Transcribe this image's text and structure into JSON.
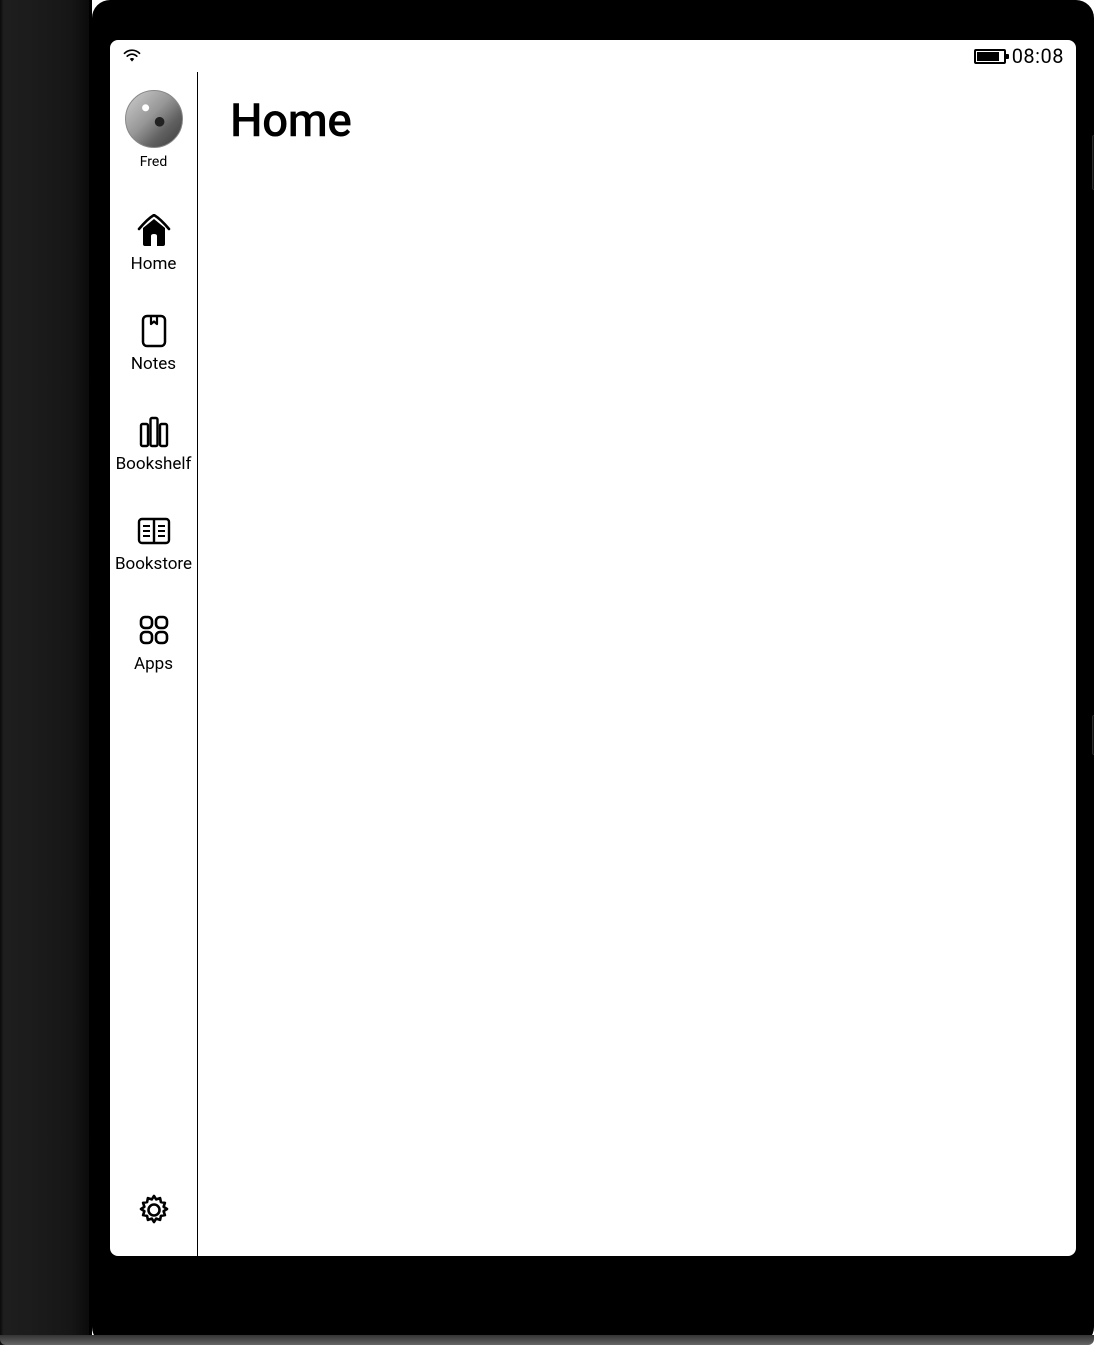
{
  "status": {
    "wifi_strength": 3,
    "battery_percent": 80,
    "clock": "08:08"
  },
  "profile": {
    "name": "Fred"
  },
  "sidebar": {
    "items": [
      {
        "id": "home",
        "label": "Home",
        "icon": "home-icon",
        "active": true
      },
      {
        "id": "notes",
        "label": "Notes",
        "icon": "notebook-icon",
        "active": false
      },
      {
        "id": "bookshelf",
        "label": "Bookshelf",
        "icon": "bookshelf-icon",
        "active": false
      },
      {
        "id": "bookstore",
        "label": "Bookstore",
        "icon": "bookstore-icon",
        "active": false
      },
      {
        "id": "apps",
        "label": "Apps",
        "icon": "apps-grid-icon",
        "active": false
      }
    ]
  },
  "settings": {
    "label": "Settings"
  },
  "main": {
    "title": "Home"
  }
}
